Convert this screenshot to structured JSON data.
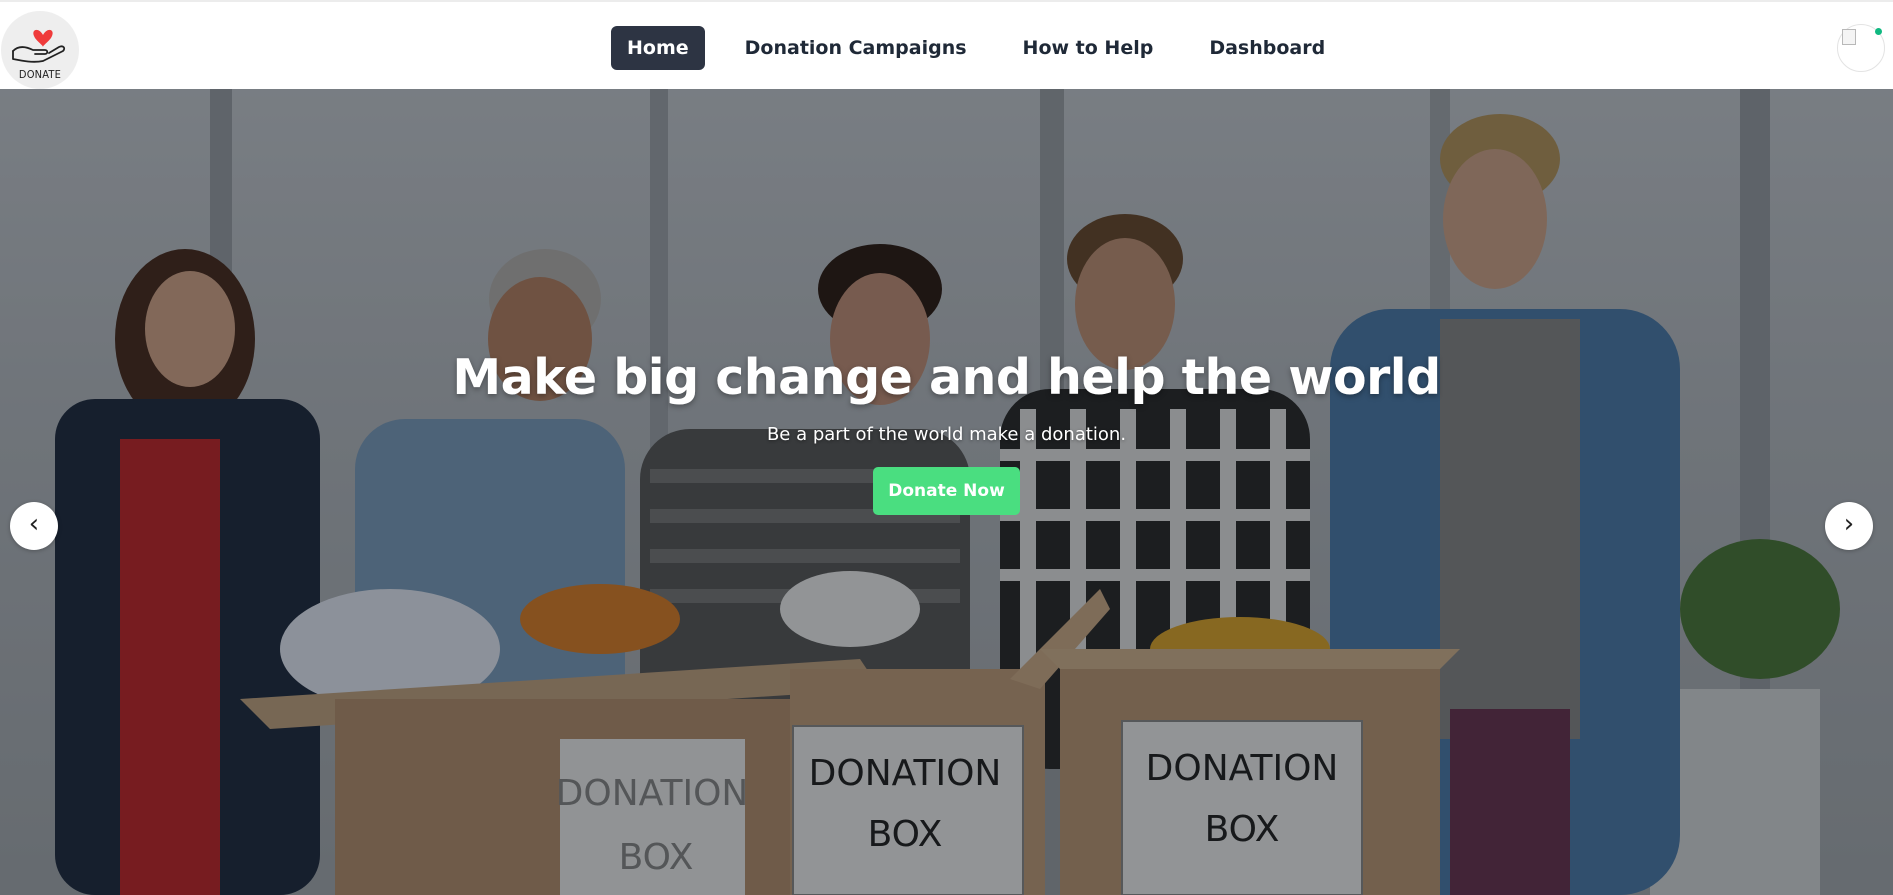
{
  "brand": {
    "logo_text": "DONATE",
    "logo_icon": "hand-heart-icon",
    "accent_heart": "#ef3b3b"
  },
  "nav": {
    "items": [
      {
        "label": "Home",
        "active": true
      },
      {
        "label": "Donation Campaigns",
        "active": false
      },
      {
        "label": "How to Help",
        "active": false
      },
      {
        "label": "Dashboard",
        "active": false
      }
    ],
    "active_bg": "#2d3443"
  },
  "user": {
    "avatar_icon": "broken-image-icon",
    "status_color": "#10b981"
  },
  "hero": {
    "title": "Make big change and help the world",
    "subtitle": "Be a part of the world make a donation.",
    "cta_label": "Donate Now",
    "cta_color": "#4ade80",
    "box_labels": [
      {
        "line1": "DONATION",
        "line2": "BOX"
      },
      {
        "line1": "DONATION",
        "line2": "BOX"
      },
      {
        "line1": "DONATION",
        "line2": "BOX"
      }
    ]
  },
  "carousel": {
    "prev_icon": "chevron-left-icon",
    "next_icon": "chevron-right-icon",
    "prev_glyph": "‹",
    "next_glyph": "›"
  }
}
